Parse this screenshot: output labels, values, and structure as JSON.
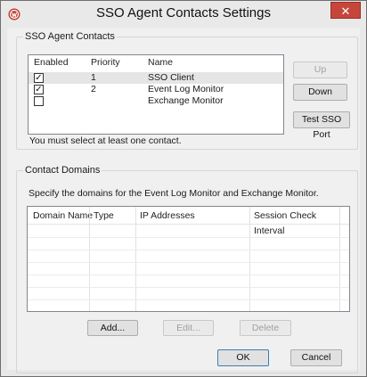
{
  "window": {
    "title": "SSO Agent Contacts Settings",
    "close_glyph": "✕",
    "app_icon": "watchguard-logo-icon"
  },
  "contacts_group": {
    "legend": "SSO Agent Contacts",
    "columns": [
      "Enabled",
      "Priority",
      "Name"
    ],
    "rows": [
      {
        "enabled": true,
        "priority": "1",
        "name": "SSO Client"
      },
      {
        "enabled": true,
        "priority": "2",
        "name": "Event Log Monitor"
      },
      {
        "enabled": false,
        "priority": "",
        "name": "Exchange Monitor"
      }
    ],
    "up_label": "Up",
    "down_label": "Down",
    "test_label": "Test SSO Port",
    "note": "You must select at least one contact."
  },
  "domains_group": {
    "legend": "Contact Domains",
    "description": "Specify the domains for the Event Log Monitor and Exchange Monitor.",
    "columns": [
      "Domain Name",
      "Type",
      "IP Addresses",
      "Session Check Interval"
    ],
    "add_label": "Add...",
    "edit_label": "Edit...",
    "delete_label": "Delete"
  },
  "footer": {
    "ok_label": "OK",
    "cancel_label": "Cancel"
  },
  "colors": {
    "close_button": "#c7463c",
    "selected_row": "#e5e5e5",
    "logo": "#c0392b"
  }
}
